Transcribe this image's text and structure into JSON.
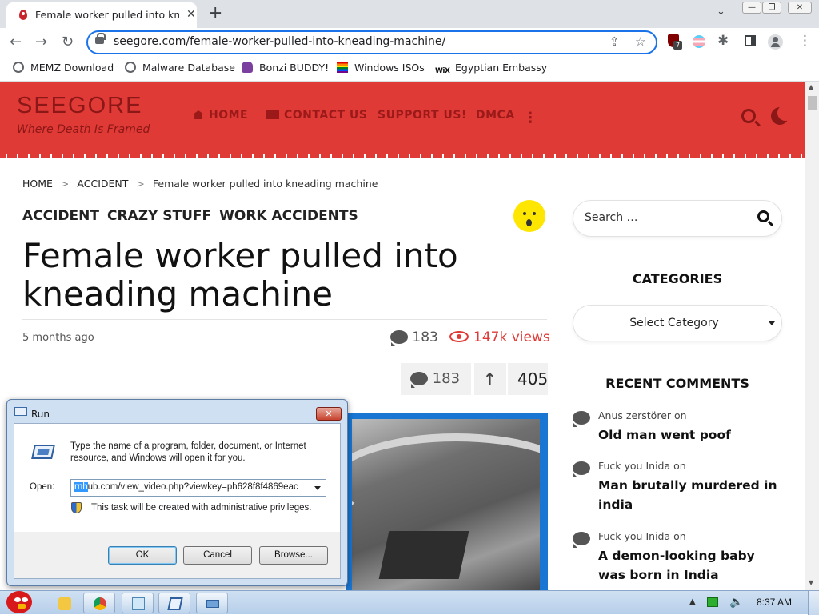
{
  "browser": {
    "tab_title": "Female worker pulled into kne",
    "url": "seegore.com/female-worker-pulled-into-kneading-machine/",
    "ext_badge": "7",
    "bookmarks": [
      {
        "label": "MEMZ Download",
        "icon": "globe-icon"
      },
      {
        "label": "Malware Database",
        "icon": "globe-icon"
      },
      {
        "label": "Bonzi BUDDY!",
        "icon": "bonzi-icon"
      },
      {
        "label": "Windows ISOs",
        "icon": "rainbow-flag-icon"
      },
      {
        "label": "Egyptian Embassy",
        "icon": "wix-icon"
      }
    ]
  },
  "site": {
    "logo": "SEEGORE",
    "tagline": "Where Death Is Framed",
    "menu": [
      "HOME",
      "CONTACT US",
      "SUPPORT US!",
      "DMCA"
    ],
    "accent": "#e03a37"
  },
  "article": {
    "breadcrumb": [
      "HOME",
      "ACCIDENT",
      "Female worker pulled into kneading machine"
    ],
    "categories": [
      "ACCIDENT",
      "CRAZY STUFF",
      "WORK ACCIDENTS"
    ],
    "title": "Female worker pulled into kneading machine",
    "posted": "5 months ago",
    "comments": "183",
    "views": "147k views",
    "vote_comments": "183",
    "votes": "405"
  },
  "sidebar": {
    "search_placeholder": "Search …",
    "categories_heading": "CATEGORIES",
    "category_select": "Select Category",
    "recent_heading": "RECENT COMMENTS",
    "recent": [
      {
        "author": "Anus zerstörer",
        "on": "on",
        "post": "Old man went poof"
      },
      {
        "author": "Fuck you Inida",
        "on": "on",
        "post": "Man brutally murdered in india"
      },
      {
        "author": "Fuck you Inida",
        "on": "on",
        "post": "A demon-looking baby was born in India"
      }
    ]
  },
  "run_dialog": {
    "title": "Run",
    "close": "✕",
    "description": "Type the name of a program, folder, document, or Internet resource, and Windows will open it for you.",
    "open_label": "Open:",
    "open_value_selected": "rnh",
    "open_value_rest": "ub.com/view_video.php?viewkey=ph628f8f4869eac",
    "admin_note": "This task will be created with administrative privileges.",
    "ok": "OK",
    "cancel": "Cancel",
    "browse": "Browse..."
  },
  "taskbar": {
    "clock": "8:37 AM"
  }
}
